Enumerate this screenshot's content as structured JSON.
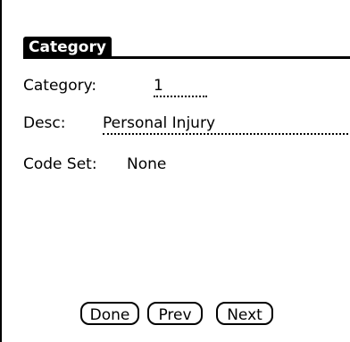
{
  "form": {
    "title": "Category",
    "fields": {
      "category": {
        "label": "Category:",
        "value": "1"
      },
      "desc": {
        "label": "Desc:",
        "value": "Personal Injury"
      },
      "code_set": {
        "label": "Code Set:",
        "value": "None"
      }
    }
  },
  "buttons": {
    "done": "Done",
    "prev": "Prev",
    "next": "Next"
  }
}
